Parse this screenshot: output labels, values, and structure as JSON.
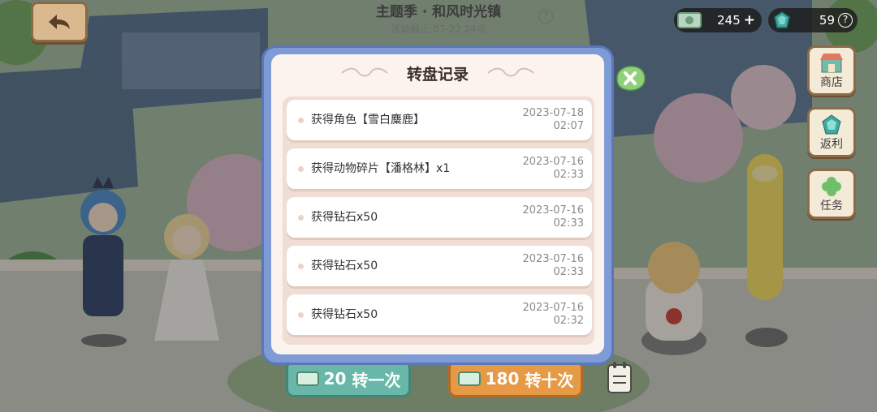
{
  "header": {
    "title": "主题季 · 和风时光镇",
    "subtitle": "活动截止:07-22 24点",
    "help": "?"
  },
  "currency": {
    "tickets": "245",
    "tickets_add": "+",
    "gems": "59",
    "gems_help": "?"
  },
  "side_buttons": {
    "shop": "商店",
    "rebate": "返利",
    "tasks": "任务"
  },
  "modal": {
    "title": "转盘记录",
    "records": [
      {
        "text": "获得角色【雪白麋鹿】",
        "date": "2023-07-18",
        "time": "02:07"
      },
      {
        "text": "获得动物碎片【潘格林】x1",
        "date": "2023-07-16",
        "time": "02:33"
      },
      {
        "text": "获得钻石x50",
        "date": "2023-07-16",
        "time": "02:33"
      },
      {
        "text": "获得钻石x50",
        "date": "2023-07-16",
        "time": "02:33"
      },
      {
        "text": "获得钻石x50",
        "date": "2023-07-16",
        "time": "02:32"
      }
    ]
  },
  "spin": {
    "once_cost": "20",
    "once_label": "转一次",
    "ten_cost": "180",
    "ten_label": "转十次"
  },
  "colors": {
    "modal_frame": "#7f9bd6",
    "modal_bg": "#fcf3ee",
    "list_bg": "#f0ddd3",
    "close_green": "#8fd07a"
  }
}
